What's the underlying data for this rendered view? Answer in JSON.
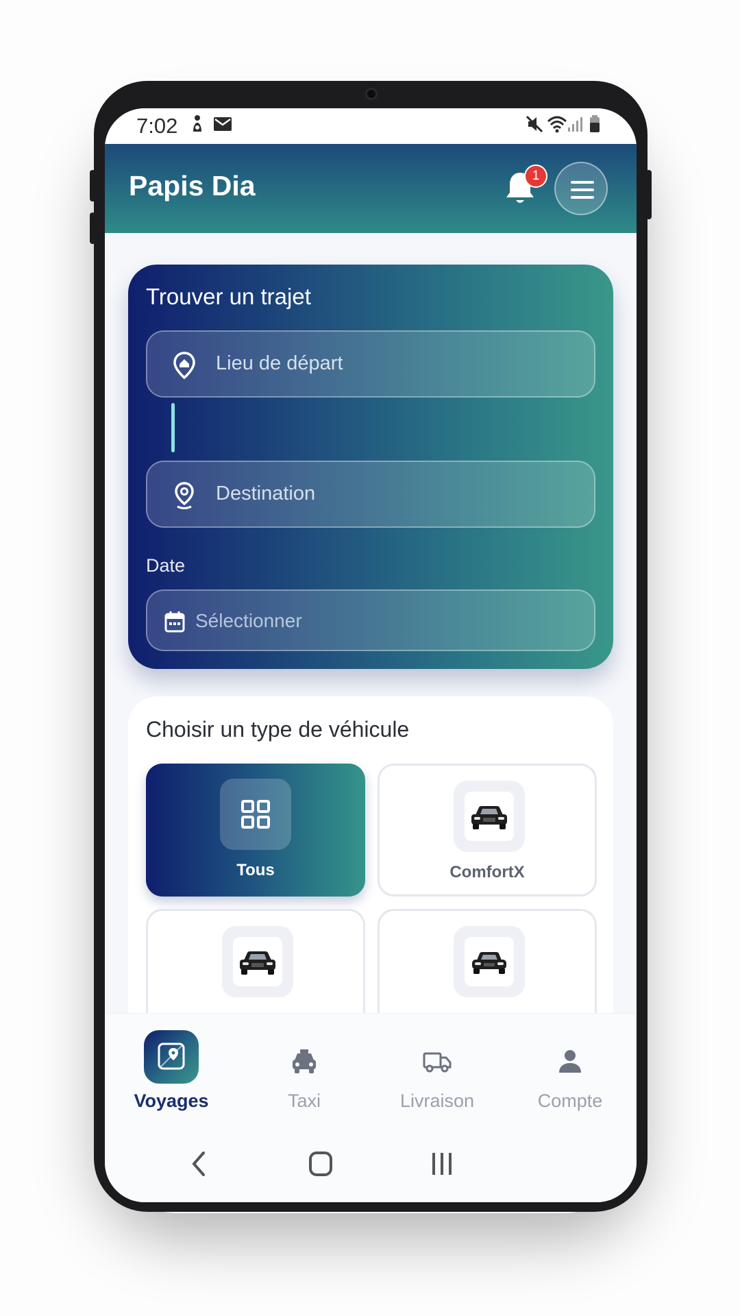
{
  "status_bar": {
    "time": "7:02"
  },
  "header": {
    "user_name": "Papis Dia",
    "notification_count": "1"
  },
  "search_card": {
    "title": "Trouver un trajet",
    "departure_placeholder": "Lieu de départ",
    "destination_placeholder": "Destination",
    "date_label": "Date",
    "date_placeholder": "Sélectionner"
  },
  "vehicle_section": {
    "title": "Choisir un type de véhicule",
    "types": [
      {
        "label": "Tous",
        "selected": true,
        "icon": "grid-icon"
      },
      {
        "label": "ComfortX",
        "selected": false,
        "icon": "car-front-icon"
      },
      {
        "label": "",
        "selected": false,
        "icon": "car-front-icon"
      },
      {
        "label": "",
        "selected": false,
        "icon": "car-front-icon"
      }
    ]
  },
  "bottom_nav": {
    "items": [
      {
        "label": "Voyages",
        "icon": "map-pin-icon",
        "active": true
      },
      {
        "label": "Taxi",
        "icon": "taxi-icon",
        "active": false
      },
      {
        "label": "Livraison",
        "icon": "truck-icon",
        "active": false
      },
      {
        "label": "Compte",
        "icon": "person-icon",
        "active": false
      }
    ]
  },
  "colors": {
    "header_gradient_top": "#1c4a7a",
    "header_gradient_bottom": "#2f8a88",
    "card_gradient_start": "#101f6e",
    "card_gradient_end": "#3a978a",
    "badge": "#e53935",
    "active_nav_text": "#1a2f6b"
  }
}
